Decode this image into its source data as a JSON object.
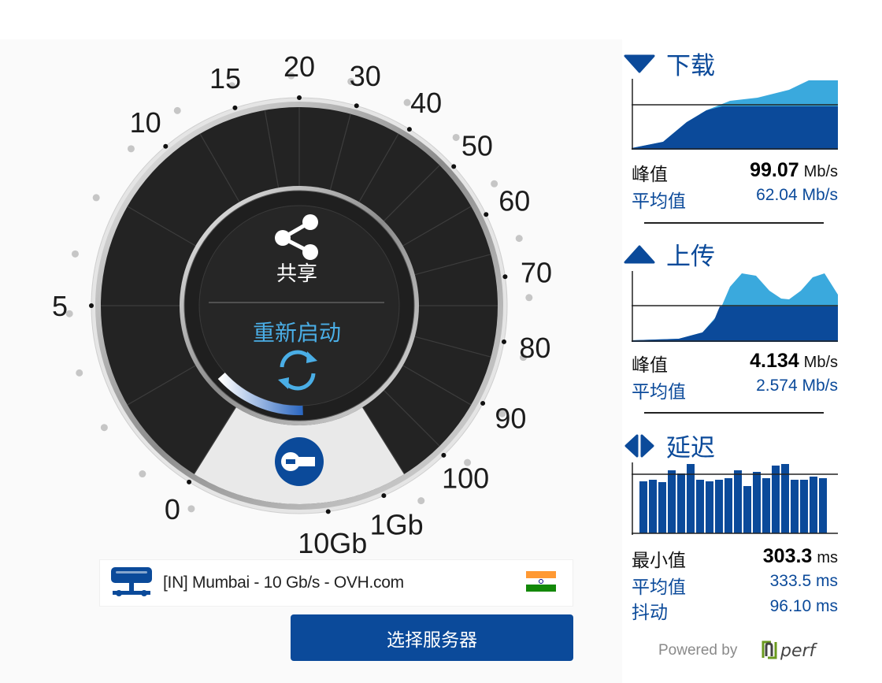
{
  "gauge": {
    "ticks": [
      "0",
      "5",
      "10",
      "15",
      "20",
      "30",
      "40",
      "50",
      "60",
      "70",
      "80",
      "90",
      "100",
      "1Gb",
      "10Gb"
    ],
    "share_label": "共享",
    "restart_label": "重新启动",
    "progress": 0.3
  },
  "server": {
    "name": "[IN] Mumbai - 10 Gb/s - OVH.com",
    "flag": "india-flag"
  },
  "select_button": "选择服务器",
  "download": {
    "title": "下载",
    "peak_label": "峰值",
    "peak_value": "99.07",
    "peak_unit": "Mb/s",
    "avg_label": "平均值",
    "avg_value": "62.04 Mb/s"
  },
  "upload": {
    "title": "上传",
    "peak_label": "峰值",
    "peak_value": "4.134",
    "peak_unit": "Mb/s",
    "avg_label": "平均值",
    "avg_value": "2.574 Mb/s"
  },
  "latency": {
    "title": "延迟",
    "min_label": "最小值",
    "min_value": "303.3",
    "min_unit": "ms",
    "avg_label": "平均值",
    "avg_value": "333.5 ms",
    "jitter_label": "抖动",
    "jitter_value": "96.10 ms"
  },
  "powered_by": "Powered by",
  "brand": "nperf",
  "colors": {
    "primary": "#0b4a9a",
    "accent": "#3aa9dd",
    "gauge_dark": "#232323"
  }
}
